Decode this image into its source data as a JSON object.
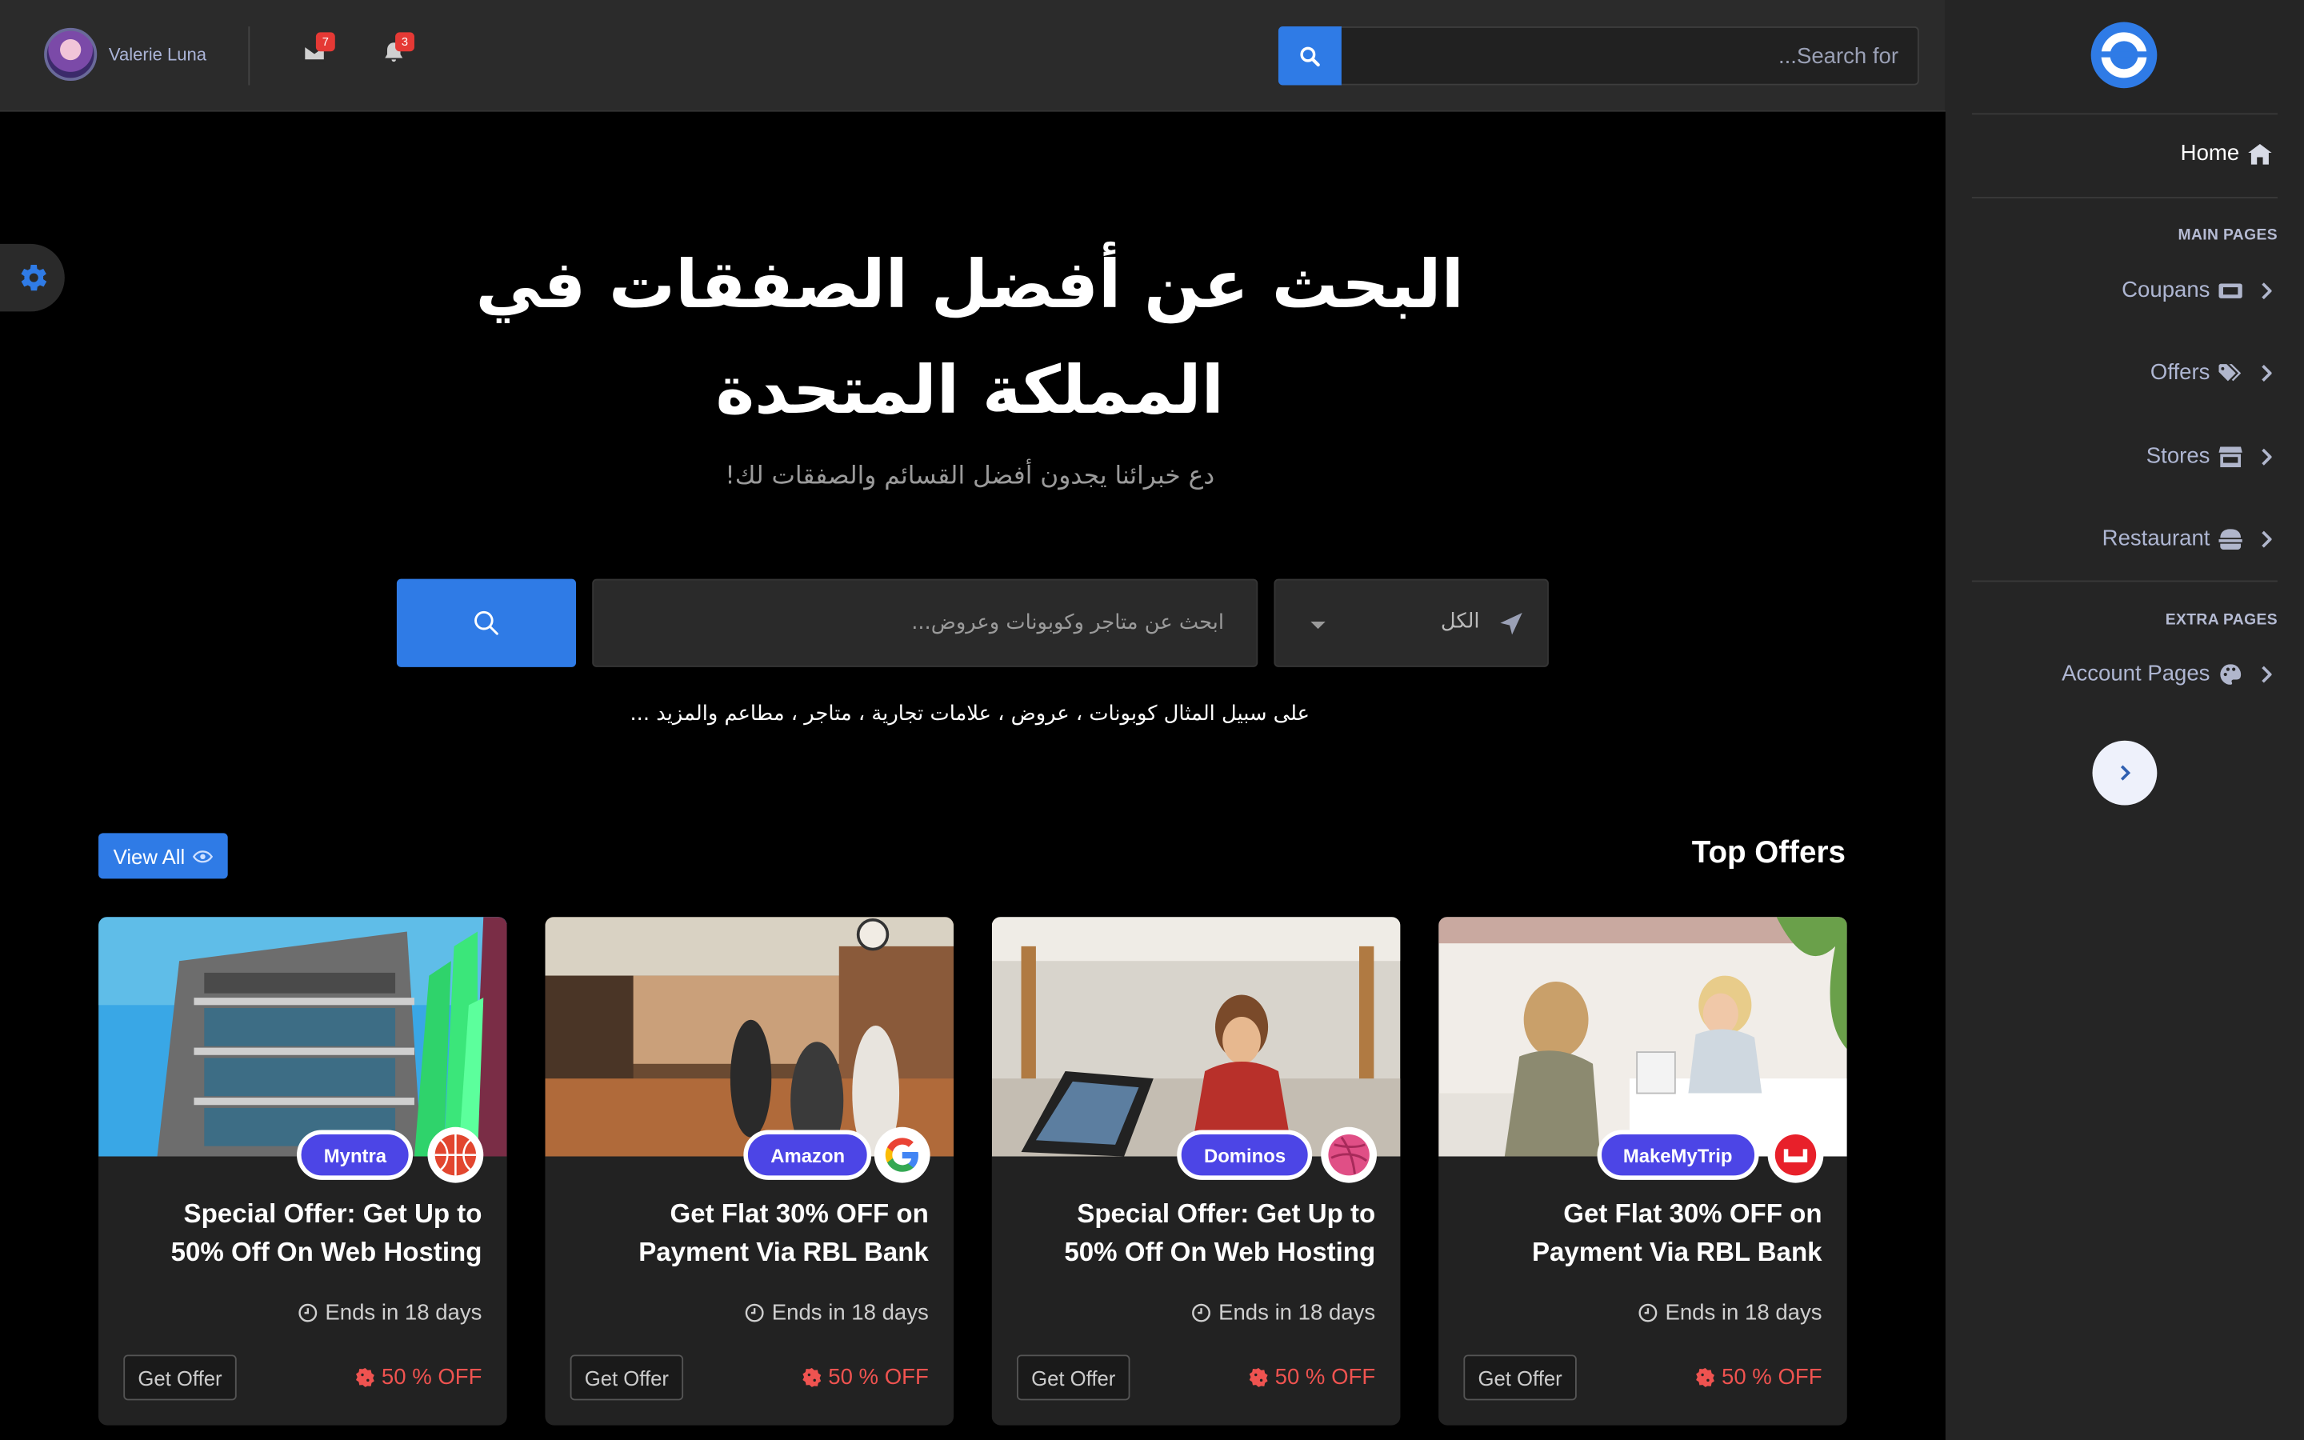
{
  "user": {
    "name": "Valerie Luna"
  },
  "notifications": {
    "mail_count": "7",
    "bell_count": "3"
  },
  "top_search": {
    "placeholder": "...Search for"
  },
  "sidebar": {
    "home_label": "Home",
    "main_header": "MAIN PAGES",
    "items": [
      {
        "label": "Coupans",
        "icon": "ticket-icon"
      },
      {
        "label": "Offers",
        "icon": "tags-icon"
      },
      {
        "label": "Stores",
        "icon": "store-icon"
      },
      {
        "label": "Restaurant",
        "icon": "burger-icon"
      }
    ],
    "extra_header": "EXTRA PAGES",
    "extra_items": [
      {
        "label": "Account Pages",
        "icon": "palette-icon"
      }
    ]
  },
  "hero": {
    "title": "البحث عن أفضل الصفقات في المملكة المتحدة",
    "subtitle": "دع خبرائنا يجدون أفضل القسائم والصفقات لك!",
    "search_placeholder": "ابحث عن متاجر وكوبونات وعروض...",
    "location_value": "الكل",
    "hint": "على سبيل المثال كوبونات ، عروض ، علامات تجارية ، متاجر ، مطاعم والمزيد ..."
  },
  "offers": {
    "section_title": "Top Offers",
    "view_all_label": "View All",
    "cards": [
      {
        "brand": "Myntra",
        "title": "Special Offer: Get Up to 50% Off On Web Hosting",
        "ends": "Ends in 18 days",
        "cta": "Get Offer",
        "discount": "50 % OFF"
      },
      {
        "brand": "Amazon",
        "title": "Get Flat 30% OFF on Payment Via RBL Bank",
        "ends": "Ends in 18 days",
        "cta": "Get Offer",
        "discount": "50 % OFF"
      },
      {
        "brand": "Dominos",
        "title": "Special Offer: Get Up to 50% Off On Web Hosting",
        "ends": "Ends in 18 days",
        "cta": "Get Offer",
        "discount": "50 % OFF"
      },
      {
        "brand": "MakeMyTrip",
        "title": "Get Flat 30% OFF on Payment Via RBL Bank",
        "ends": "Ends in 18 days",
        "cta": "Get Offer",
        "discount": "50 % OFF"
      }
    ]
  },
  "colors": {
    "accent": "#2f7be6",
    "pill": "#4c45e6",
    "discount": "#ef5350",
    "badge": "#e53935"
  }
}
